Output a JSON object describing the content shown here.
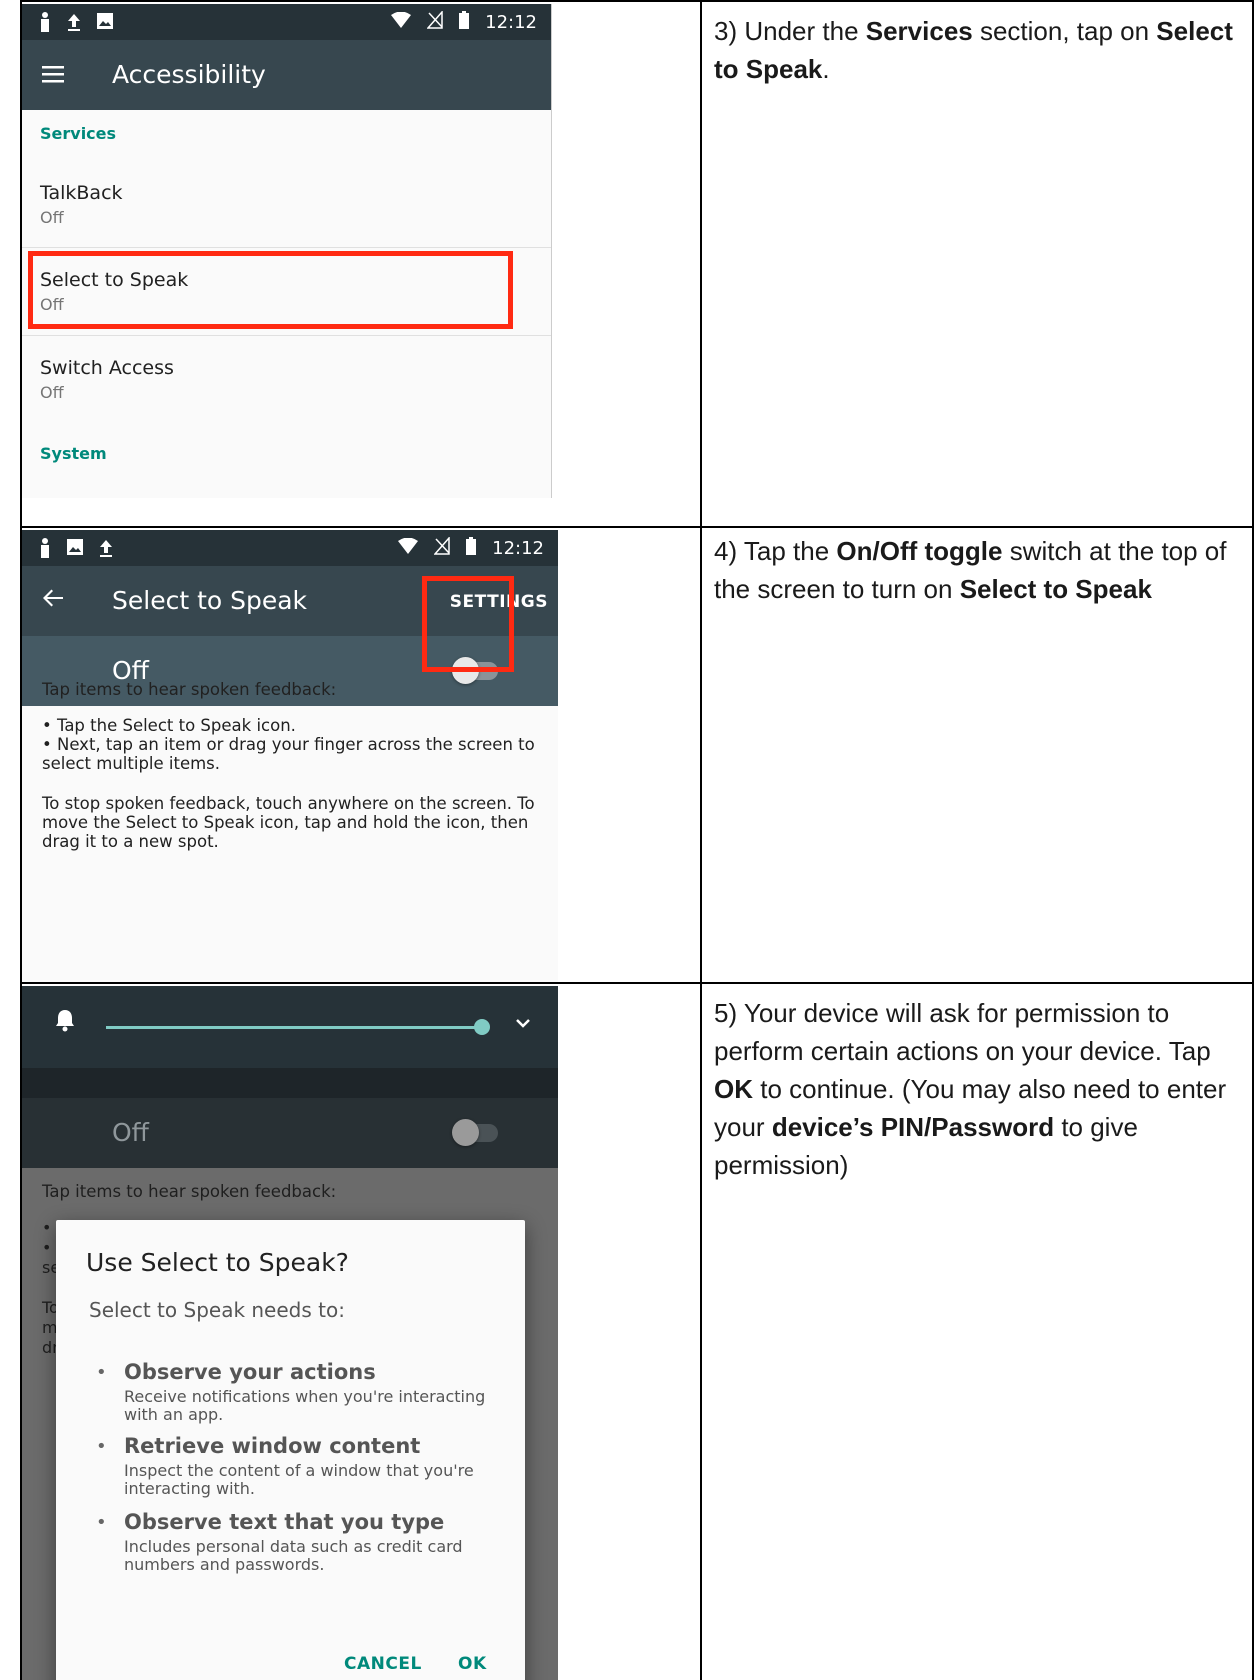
{
  "steps": [
    {
      "text_parts": [
        {
          "t": "3) Under the ",
          "b": false
        },
        {
          "t": "Services",
          "b": true
        },
        {
          "t": " section, tap on ",
          "b": false
        },
        {
          "t": "Select to Speak",
          "b": true
        },
        {
          "t": ".",
          "b": false
        }
      ]
    },
    {
      "text_parts": [
        {
          "t": "4) Tap the ",
          "b": false
        },
        {
          "t": "On/Off toggle",
          "b": true
        },
        {
          "t": " switch at the top of the screen to turn on ",
          "b": false
        },
        {
          "t": "Select to Speak",
          "b": true
        }
      ]
    },
    {
      "text_parts": [
        {
          "t": "5) Your device will ask for permission to perform certain actions on your device. Tap ",
          "b": false
        },
        {
          "t": "OK",
          "b": true
        },
        {
          "t": " to continue. (You may also need to enter your ",
          "b": false
        },
        {
          "t": "device’s PIN/Password",
          "b": true
        },
        {
          "t": " to give permission)",
          "b": false
        }
      ]
    }
  ],
  "screen1": {
    "time": "12:12",
    "title": "Accessibility",
    "section_services": "Services",
    "items": [
      {
        "name": "TalkBack",
        "summary": "Off"
      },
      {
        "name": "Select to Speak",
        "summary": "Off"
      },
      {
        "name": "Switch Access",
        "summary": "Off"
      }
    ],
    "section_system": "System"
  },
  "screen2": {
    "time": "12:12",
    "title": "Select to Speak",
    "action": "SETTINGS",
    "toggle_label": "Off",
    "desc_intro": "Tap items to hear spoken feedback:",
    "desc_bullet1": "• Tap the Select to Speak icon.",
    "desc_bullet2a": "• Next, tap an item or drag your finger across the screen to",
    "desc_bullet2b": "select multiple items.",
    "desc_stop1": "To stop spoken feedback, touch anywhere on the screen. To",
    "desc_stop2": "move the Select to Speak icon, tap and hold the icon, then",
    "desc_stop3": "drag it to a new spot."
  },
  "screen3": {
    "toggle_label": "Off",
    "desc_intro": "Tap items to hear spoken feedback:",
    "frag1": "• T",
    "frag2": "• N",
    "frag3": "se",
    "frag4": "To",
    "frag5": "m",
    "frag6": "dr",
    "dialog": {
      "title": "Use Select to Speak?",
      "subtitle": "Select to Speak needs to:",
      "permissions": [
        {
          "title": "Observe your actions",
          "desc": "Receive notifications when you're interacting with an app."
        },
        {
          "title": "Retrieve window content",
          "desc": "Inspect the content of a window that you're interacting with."
        },
        {
          "title": "Observe text that you type",
          "desc": "Includes personal data such as credit card numbers and passwords."
        }
      ],
      "cancel": "CANCEL",
      "ok": "OK"
    }
  },
  "icons": [
    "person-icon",
    "upload-icon",
    "image-icon",
    "wifi-icon",
    "no-sim-icon",
    "battery-icon",
    "menu-icon",
    "back-arrow-icon",
    "bell-icon",
    "chevron-down-icon"
  ],
  "colors": {
    "highlight": "#ff2a12",
    "accent": "#00897b",
    "appbar": "#37474f",
    "statusbar": "#263238"
  }
}
